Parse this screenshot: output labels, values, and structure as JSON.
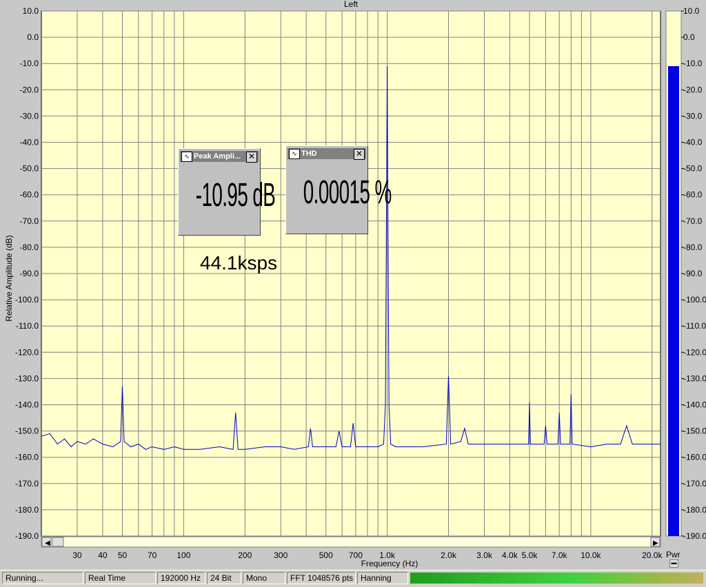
{
  "window": {
    "channel_title": "Left",
    "annotation": "44.1ksps",
    "power_label": "Pwr"
  },
  "meters": {
    "peak": {
      "title": "Peak Ampli...",
      "value": "-10.95 dB"
    },
    "thd": {
      "title": "THD",
      "value": "0.00015 %"
    }
  },
  "statusbar": {
    "state": "Running...",
    "mode": "Real Time",
    "sample_rate": "192000 Hz",
    "bit_depth": "24 Bit",
    "channels": "Mono",
    "fft_size": "FFT 1048576 pts",
    "window_fn": "Hanning"
  },
  "colors": {
    "plot_bg": "#ffffcc",
    "trace": "#0000cc",
    "power_bar": "#0000e6",
    "grid": "#808080"
  },
  "power_level_db": -11,
  "chart_data": {
    "type": "line",
    "title": "Left",
    "xlabel": "Frequency (Hz)",
    "ylabel": "Relative Amplitude (dB)",
    "x_scale": "log",
    "xlim": [
      20,
      22000
    ],
    "ylim": [
      -190,
      10
    ],
    "grid": true,
    "x_ticks": [
      {
        "v": 30,
        "label": "30"
      },
      {
        "v": 40,
        "label": "40"
      },
      {
        "v": 50,
        "label": "50"
      },
      {
        "v": 70,
        "label": "70"
      },
      {
        "v": 100,
        "label": "100"
      },
      {
        "v": 200,
        "label": "200"
      },
      {
        "v": 300,
        "label": "300"
      },
      {
        "v": 500,
        "label": "500"
      },
      {
        "v": 700,
        "label": "700"
      },
      {
        "v": 1000,
        "label": "1.0k"
      },
      {
        "v": 2000,
        "label": "2.0k"
      },
      {
        "v": 3000,
        "label": "3.0k"
      },
      {
        "v": 4000,
        "label": "4.0k"
      },
      {
        "v": 5000,
        "label": "5.0k"
      },
      {
        "v": 7000,
        "label": "7.0k"
      },
      {
        "v": 10000,
        "label": "10.0k"
      },
      {
        "v": 20000,
        "label": "20.0k"
      }
    ],
    "y_ticks": [
      {
        "v": 10,
        "label": "10.0"
      },
      {
        "v": 0,
        "label": "0.0"
      },
      {
        "v": -10,
        "label": "-10.0"
      },
      {
        "v": -20,
        "label": "-20.0"
      },
      {
        "v": -30,
        "label": "-30.0"
      },
      {
        "v": -40,
        "label": "-40.0"
      },
      {
        "v": -50,
        "label": "-50.0"
      },
      {
        "v": -60,
        "label": "-60.0"
      },
      {
        "v": -70,
        "label": "-70.0"
      },
      {
        "v": -80,
        "label": "-80.0"
      },
      {
        "v": -90,
        "label": "-90.0"
      },
      {
        "v": -100,
        "label": "-100.0"
      },
      {
        "v": -110,
        "label": "-110.0"
      },
      {
        "v": -120,
        "label": "-120.0"
      },
      {
        "v": -130,
        "label": "-130.0"
      },
      {
        "v": -140,
        "label": "-140.0"
      },
      {
        "v": -150,
        "label": "-150.0"
      },
      {
        "v": -160,
        "label": "-160.0"
      },
      {
        "v": -170,
        "label": "-170.0"
      },
      {
        "v": -180,
        "label": "-180.0"
      },
      {
        "v": -190,
        "label": "-190.0"
      }
    ],
    "series": [
      {
        "points": [
          [
            20,
            -152
          ],
          [
            22,
            -151
          ],
          [
            24,
            -155
          ],
          [
            26,
            -153
          ],
          [
            28,
            -156
          ],
          [
            30,
            -154
          ],
          [
            33,
            -155
          ],
          [
            36,
            -153
          ],
          [
            40,
            -155
          ],
          [
            45,
            -156
          ],
          [
            49,
            -154
          ],
          [
            50,
            -133
          ],
          [
            51,
            -154
          ],
          [
            55,
            -156
          ],
          [
            60,
            -155
          ],
          [
            65,
            -157
          ],
          [
            70,
            -156
          ],
          [
            80,
            -157
          ],
          [
            90,
            -156
          ],
          [
            100,
            -157
          ],
          [
            120,
            -157
          ],
          [
            150,
            -156
          ],
          [
            175,
            -157
          ],
          [
            180,
            -143
          ],
          [
            185,
            -157
          ],
          [
            200,
            -157
          ],
          [
            250,
            -156
          ],
          [
            300,
            -156
          ],
          [
            350,
            -157
          ],
          [
            410,
            -156
          ],
          [
            420,
            -149
          ],
          [
            430,
            -156
          ],
          [
            500,
            -156
          ],
          [
            560,
            -156
          ],
          [
            580,
            -150
          ],
          [
            600,
            -156
          ],
          [
            660,
            -156
          ],
          [
            680,
            -147
          ],
          [
            700,
            -156
          ],
          [
            800,
            -156
          ],
          [
            900,
            -156
          ],
          [
            960,
            -155
          ],
          [
            980,
            -140
          ],
          [
            990,
            -80
          ],
          [
            1000,
            -11
          ],
          [
            1010,
            -80
          ],
          [
            1020,
            -140
          ],
          [
            1040,
            -155
          ],
          [
            1100,
            -156
          ],
          [
            1500,
            -156
          ],
          [
            1950,
            -155
          ],
          [
            2000,
            -129
          ],
          [
            2050,
            -155
          ],
          [
            2300,
            -154
          ],
          [
            2400,
            -149
          ],
          [
            2500,
            -155
          ],
          [
            3000,
            -155
          ],
          [
            3500,
            -155
          ],
          [
            4000,
            -155
          ],
          [
            4950,
            -155
          ],
          [
            5000,
            -139
          ],
          [
            5050,
            -155
          ],
          [
            5900,
            -155
          ],
          [
            6000,
            -148
          ],
          [
            6100,
            -155
          ],
          [
            6900,
            -155
          ],
          [
            7000,
            -143
          ],
          [
            7100,
            -155
          ],
          [
            7900,
            -155
          ],
          [
            8000,
            -136
          ],
          [
            8100,
            -155
          ],
          [
            10000,
            -156
          ],
          [
            12000,
            -155
          ],
          [
            14000,
            -155
          ],
          [
            15000,
            -148
          ],
          [
            16000,
            -155
          ],
          [
            18000,
            -155
          ],
          [
            20000,
            -155
          ],
          [
            22000,
            -155
          ]
        ]
      }
    ]
  }
}
